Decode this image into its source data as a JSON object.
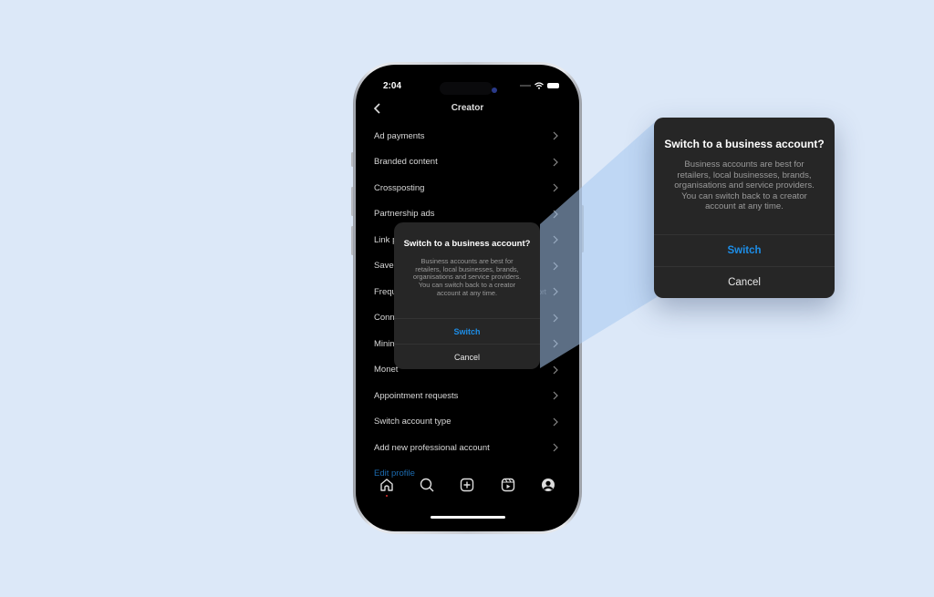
{
  "colors": {
    "background": "#dce8f8",
    "accent": "#1d8ee8",
    "dialog": "#262626",
    "link": "#1c6bb0",
    "beam": "#a8c8f0"
  },
  "status_bar": {
    "time": "2:04",
    "icons": [
      "signal-icon",
      "wifi-icon",
      "battery-icon"
    ]
  },
  "nav": {
    "back_icon": "chevron-left-icon",
    "title": "Creator"
  },
  "menu": {
    "items": [
      {
        "label": "Ad payments"
      },
      {
        "label": "Branded content"
      },
      {
        "label": "Crossposting"
      },
      {
        "label": "Partnership ads"
      },
      {
        "label": "Link p"
      },
      {
        "label": "Saved"
      },
      {
        "label": "Frequ",
        "trailing": "ort"
      },
      {
        "label": "Conne"
      },
      {
        "label": "Minim"
      },
      {
        "label": "Monet"
      },
      {
        "label": "Appointment requests"
      },
      {
        "label": "Switch account type"
      },
      {
        "label": "Add new professional account"
      }
    ],
    "link": "Edit profile"
  },
  "tab_bar": {
    "tabs": [
      "home-icon",
      "search-icon",
      "create-icon",
      "reels-icon",
      "profile-icon"
    ]
  },
  "dialog": {
    "title": "Switch to a business account?",
    "body_lines": [
      "Business accounts are best for",
      "retailers, local businesses, brands,",
      "organisations and service providers.",
      "You can switch back to a creator",
      "account at any time."
    ],
    "primary_button": "Switch",
    "secondary_button": "Cancel"
  }
}
